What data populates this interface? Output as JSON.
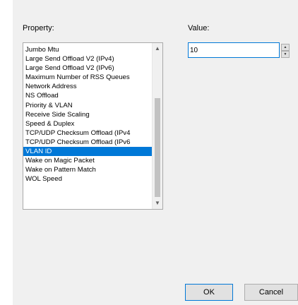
{
  "dialog": {
    "property_label": "Property:",
    "value_label": "Value:"
  },
  "property_list": {
    "items": [
      {
        "label": "Jumbo Mtu",
        "selected": false
      },
      {
        "label": "Large Send Offload V2 (IPv4)",
        "selected": false
      },
      {
        "label": "Large Send Offload V2 (IPv6)",
        "selected": false
      },
      {
        "label": "Maximum Number of RSS Queues",
        "selected": false
      },
      {
        "label": "Network Address",
        "selected": false
      },
      {
        "label": "NS Offload",
        "selected": false
      },
      {
        "label": "Priority & VLAN",
        "selected": false
      },
      {
        "label": "Receive Side Scaling",
        "selected": false
      },
      {
        "label": "Speed & Duplex",
        "selected": false
      },
      {
        "label": "TCP/UDP Checksum Offload (IPv4",
        "selected": false
      },
      {
        "label": "TCP/UDP Checksum Offload (IPv6",
        "selected": false
      },
      {
        "label": "VLAN ID",
        "selected": true
      },
      {
        "label": "Wake on Magic Packet",
        "selected": false
      },
      {
        "label": "Wake on Pattern Match",
        "selected": false
      },
      {
        "label": "WOL Speed",
        "selected": false
      }
    ],
    "selected_color": "#0078d7"
  },
  "value_field": {
    "value": "10"
  },
  "buttons": {
    "ok_label": "OK",
    "cancel_label": "Cancel"
  },
  "icons": {
    "scroll_up": "▲",
    "scroll_down": "▼",
    "spin_up": "▲",
    "spin_down": "▼"
  }
}
